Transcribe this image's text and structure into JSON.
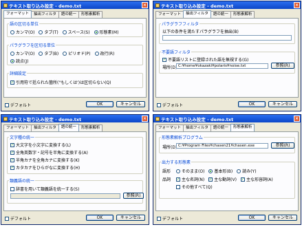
{
  "title": "テキスト取り込み設定 - demo.txt",
  "tabs": [
    "フォーマット",
    "抽出フィルタ",
    "語の統一",
    "形態素解析"
  ],
  "footer": {
    "default_label": "デフォルト",
    "ok_label": "OK",
    "cancel_label": "キャンセル"
  },
  "w1": {
    "group1": {
      "label": "語の区切る単位",
      "options": [
        "カンマ(O)",
        "タブ(T)",
        "スペース(S)",
        "形態素(M)"
      ],
      "selected": 3
    },
    "group2": {
      "label": "パラグラフを区切る単位",
      "options": [
        "カンマ(O)",
        "タブ(B)",
        "ピリオド(P)",
        "改行(R)",
        "読点(J)"
      ],
      "selected": 4
    },
    "group3": {
      "label": "詳細設定",
      "check_label": "引用符で括られた箇所(\"もしくは')は区切らない(Q)",
      "checked": true
    }
  },
  "w2": {
    "group1": {
      "label": "パラグラフフィルタ",
      "desc": "以下の条件を満たすパラグラフを抽出(B)",
      "value": ""
    },
    "group2": {
      "label": "不要語フィルタ",
      "check_label": "不要語リストに登録された語を無視する(G)",
      "checked": true,
      "place_label": "場所(D)",
      "place_value": "C:¥home¥okazaki¥polaris¥noise.txt",
      "browse_label": "参照(R)"
    }
  },
  "w3": {
    "group1": {
      "label": "文字種の統一",
      "items": [
        {
          "label": "大文字を小文字に変換する(L)",
          "checked": true
        },
        {
          "label": "全角英数字・記号を半角に変換する(A)",
          "checked": true
        },
        {
          "label": "半角カナを全角カナに変換する(K)",
          "checked": true
        },
        {
          "label": "カタカナをひらがなに変換する(H)",
          "checked": true
        }
      ]
    },
    "group2": {
      "label": "類義語の統一",
      "check_label": "辞書を用いて類義語を統一する(S)",
      "checked": false,
      "browse_label": "参照(R)"
    }
  },
  "w4": {
    "group1": {
      "label": "形態素解析プログラム",
      "place_label": "場所(D)",
      "place_value": "C:¥Program Files¥chasen21¥chasen.exe",
      "browse_label": "参照(R)"
    },
    "group2": {
      "label": "出力する形態素",
      "form_label": "語形",
      "form_options": [
        "そのまま(O)",
        "基本形(B)",
        "読み(Y)"
      ],
      "form_selected": 1,
      "pos_label": "品詞",
      "pos_items": [
        {
          "label": "主な名詞(N)",
          "checked": true
        },
        {
          "label": "主な動詞(V)",
          "checked": true
        },
        {
          "label": "主な形容詞(A)",
          "checked": true
        },
        {
          "label": "その他すべて(Q)",
          "checked": false
        }
      ]
    }
  }
}
